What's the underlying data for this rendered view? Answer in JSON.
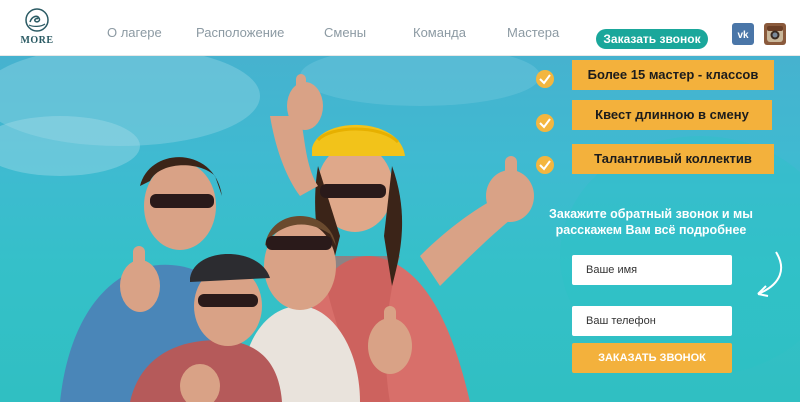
{
  "header": {
    "logo_text": "MORE",
    "nav": [
      "О лагере",
      "Расположение",
      "Смены",
      "Команда",
      "Мастера"
    ],
    "cta": "Заказать звонок",
    "social": [
      {
        "icon": "vk-icon",
        "label": "VK"
      },
      {
        "icon": "instagram-icon",
        "label": "Instagram"
      }
    ]
  },
  "hero": {
    "features": [
      "Более 15 мастер - классов",
      "Квест длинною в смену",
      "Талантливый коллектив"
    ],
    "form": {
      "heading": "Закажите обратный звонок и мы расскажем Вам всё подробнее",
      "name_placeholder": "Ваше имя",
      "phone_placeholder": "Ваш телефон",
      "submit": "ЗАКАЗАТЬ ЗВОНОК"
    }
  },
  "colors": {
    "teal": "#1aa79b",
    "accent_orange": "#f3b13c",
    "sky": "#3fbad1",
    "nav_text": "#8c9aa3",
    "vk": "#4a76a8"
  }
}
